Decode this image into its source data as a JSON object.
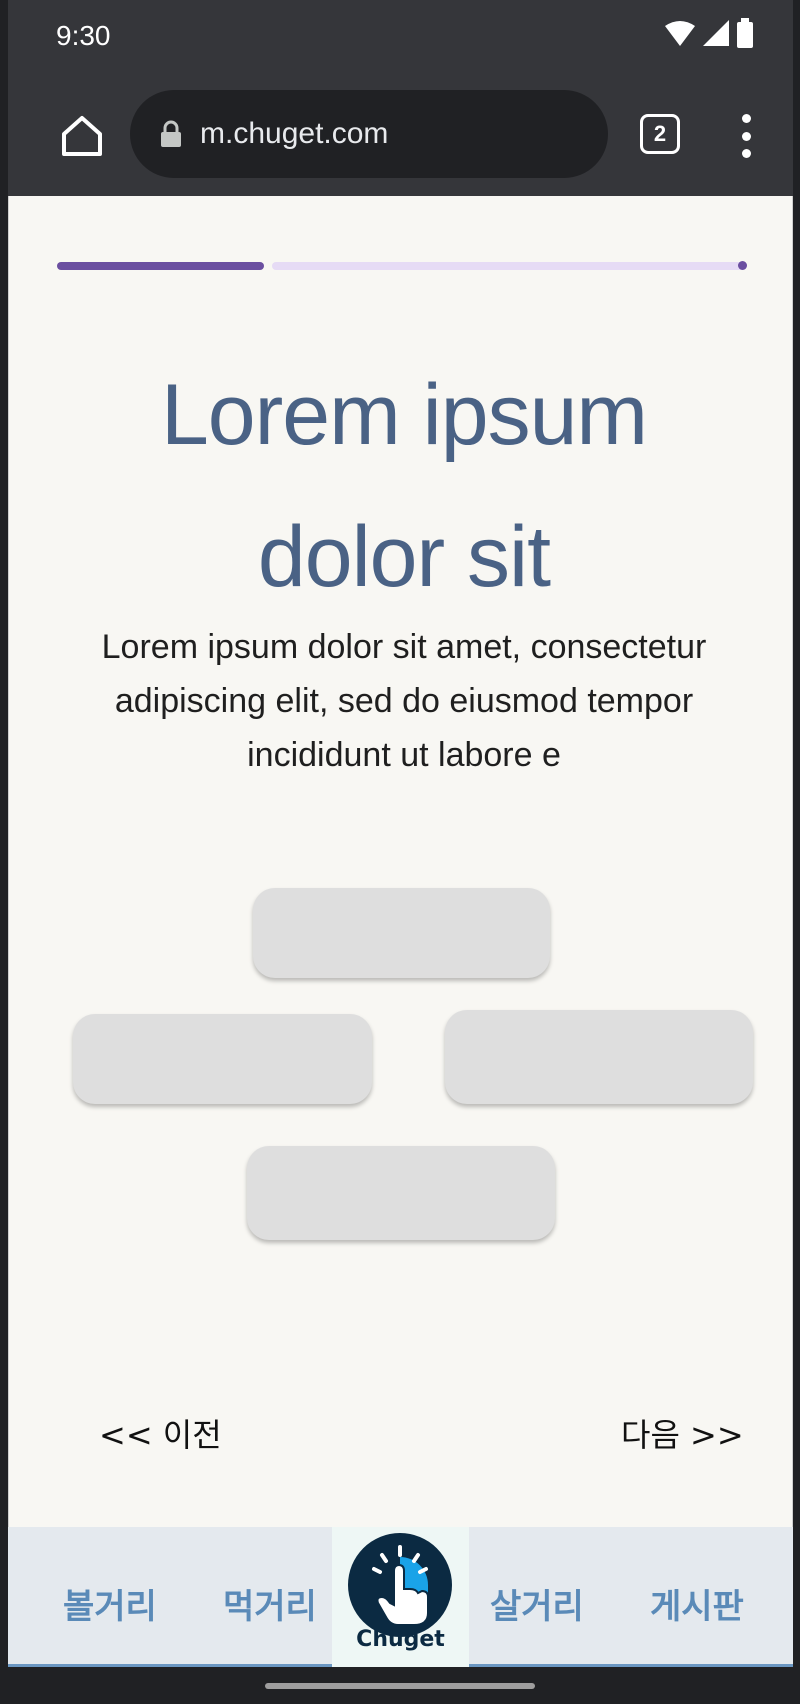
{
  "status_bar": {
    "time": "9:30"
  },
  "browser": {
    "url": "m.chuget.com",
    "tab_count": "2"
  },
  "progress": {
    "fraction": 0.3
  },
  "content": {
    "title": "Lorem ipsum dolor sit",
    "description": "Lorem ipsum dolor sit amet, consectetur adipiscing elit, sed do eiusmod tempor incididunt ut labore e"
  },
  "nav_buttons": {
    "prev": "<< 이전",
    "next": "다음 >>"
  },
  "bottom_nav": {
    "items": [
      "볼거리",
      "먹거리",
      "살거리",
      "게시판"
    ],
    "logo_text": "Chuget"
  },
  "colors": {
    "accent": "#6b4fa0",
    "title": "#4a6285",
    "nav": "#5a8ab8"
  }
}
